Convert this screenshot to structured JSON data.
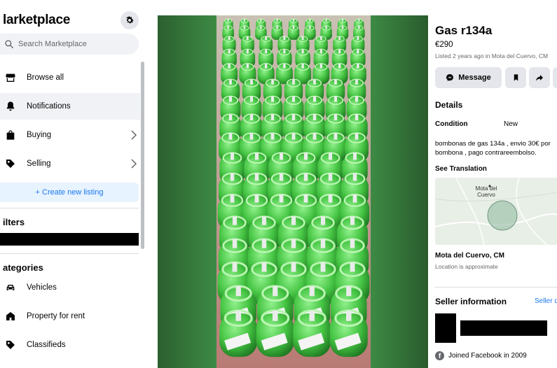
{
  "sidebar": {
    "title": "larketplace",
    "search_placeholder": "Search Marketplace",
    "nav": [
      {
        "label": "Browse all",
        "icon": "storefront-icon"
      },
      {
        "label": "Notifications",
        "icon": "bell-icon"
      },
      {
        "label": "Buying",
        "icon": "shopping-bag-icon"
      },
      {
        "label": "Selling",
        "icon": "tag-icon"
      }
    ],
    "create_listing": "+ Create new listing",
    "filters_heading": "ilters",
    "categories_heading": "ategories",
    "categories": [
      {
        "label": "Vehicles",
        "icon": "car-icon"
      },
      {
        "label": "Property for rent",
        "icon": "house-icon"
      },
      {
        "label": "Classifieds",
        "icon": "tag-icon"
      }
    ]
  },
  "listing": {
    "title": "Gas r134a",
    "price": "€290",
    "listed": "Listed 2 years ago in Mota del Cuervo, CM",
    "message_label": "Message",
    "details_heading": "Details",
    "condition_label": "Condition",
    "condition_value": "New",
    "description": "bombonas de gas 134a , envio 30€ por bombona , pago contrareembolso.",
    "see_translation": "See Translation",
    "map_label": "Mota del Cuervo",
    "location": "Mota del Cuervo, CM",
    "location_note": "Location is approximate",
    "seller_heading": "Seller information",
    "seller_link": "Seller de",
    "joined": "Joined Facebook in 2009"
  },
  "colors": {
    "accent": "#1877f2",
    "cylinder_green": "#4cc94a",
    "panel_gray": "#e4e6eb"
  }
}
